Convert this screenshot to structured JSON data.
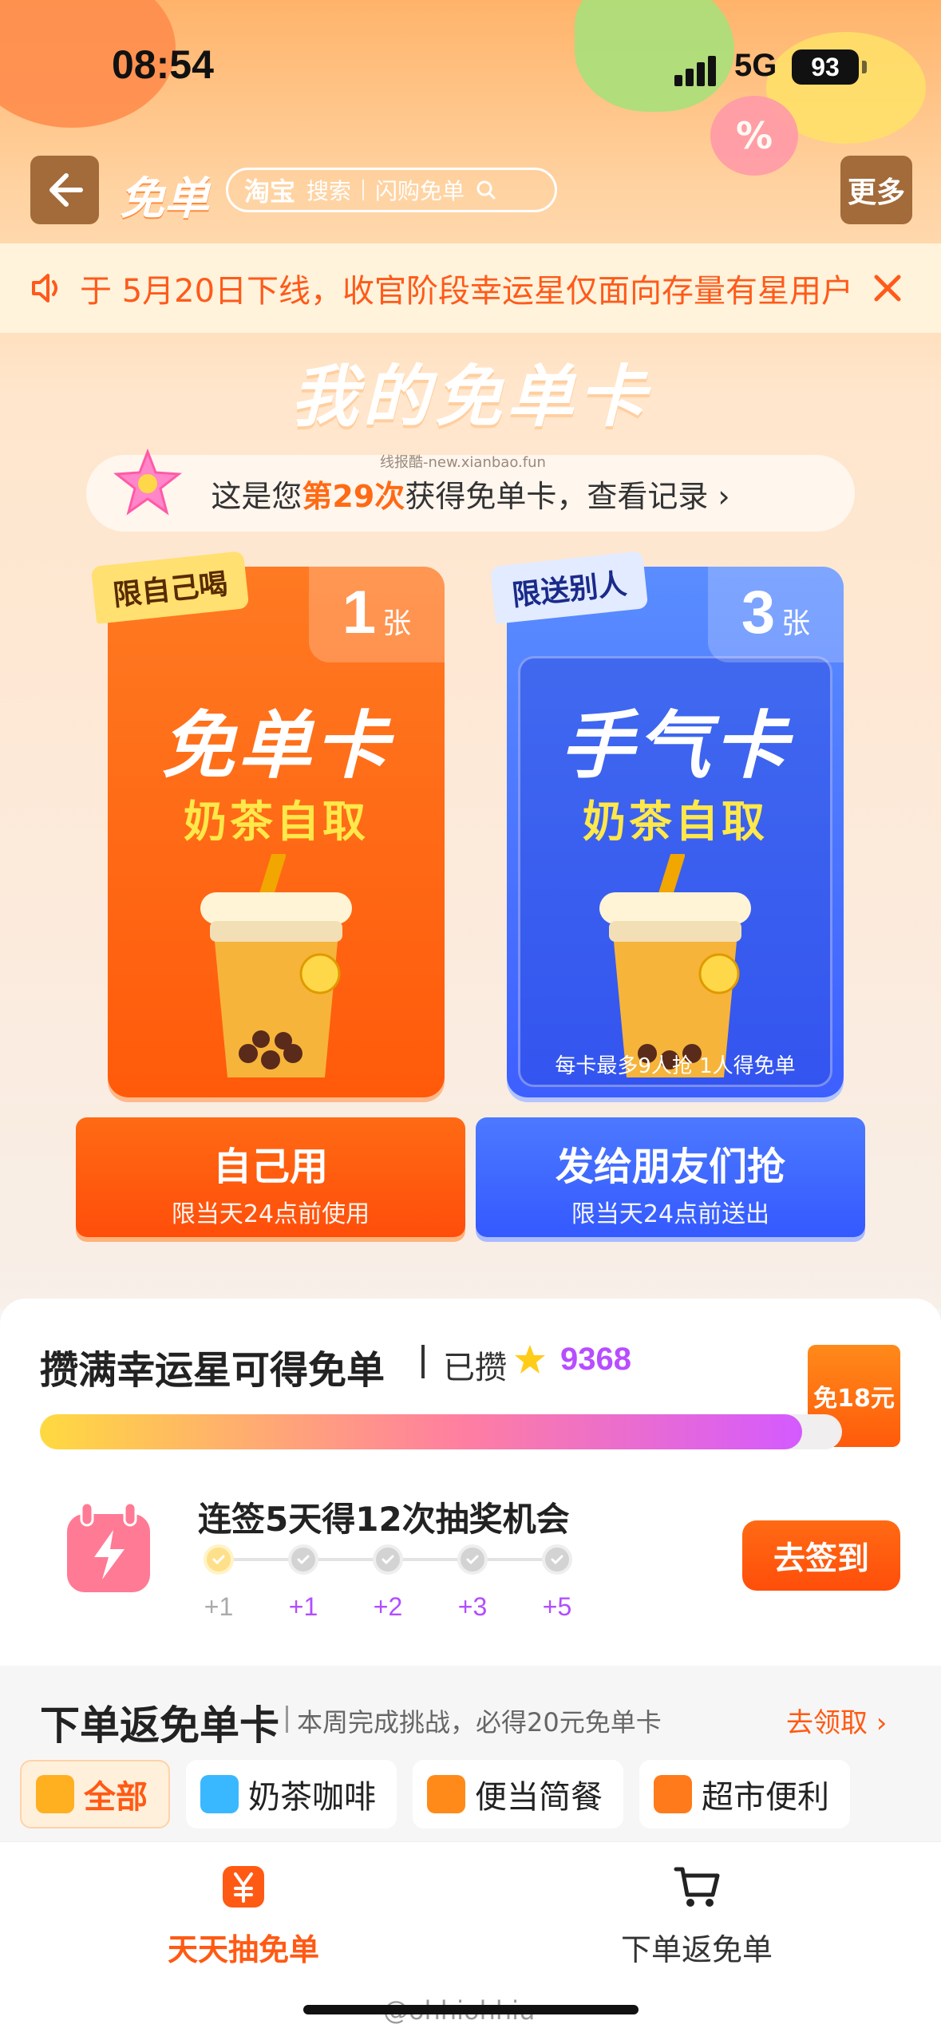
{
  "status_bar": {
    "time": "08:54",
    "network": "5G",
    "battery": "93"
  },
  "nav": {
    "title": "免单",
    "search_brand": "淘宝",
    "search_label": "搜索",
    "search_hint": "闪购免单",
    "more_label": "更多"
  },
  "notice": {
    "text": "于 5月20日下线，收官阶段幸运星仅面向存量有星用户"
  },
  "section": {
    "title": "我的免单卡",
    "watermark": "线报酷-new.xianbao.fun"
  },
  "record": {
    "prefix": "这是您",
    "highlight": "第29次",
    "suffix": "获得免单卡，查看记录 ›"
  },
  "cards": [
    {
      "tag": "限自己喝",
      "count": "1",
      "unit": "张",
      "title": "免单卡",
      "subtitle": "奶茶自取",
      "note": "",
      "btn_main": "自己用",
      "btn_sub": "限当天24点前使用"
    },
    {
      "tag": "限送别人",
      "count": "3",
      "unit": "张",
      "title": "手气卡",
      "subtitle": "奶茶自取",
      "note": "每卡最多9人抢 1人得免单",
      "btn_main": "发给朋友们抢",
      "btn_sub": "限当天24点前送出"
    }
  ],
  "lucky": {
    "title": "攒满幸运星可得免单",
    "have_label": "已攒",
    "count": "9368",
    "badge": "免18元",
    "progress": 0.95
  },
  "checkin": {
    "title": "连签5天得12次抽奖机会",
    "button": "去签到",
    "days": [
      {
        "label": "+1",
        "done": true
      },
      {
        "label": "+1",
        "done": false
      },
      {
        "label": "+2",
        "done": false
      },
      {
        "label": "+3",
        "done": false
      },
      {
        "label": "+5",
        "done": false
      }
    ]
  },
  "order": {
    "title": "下单返免单卡",
    "subtitle": "本周完成挑战，必得20元免单卡",
    "link": "去领取 ›",
    "categories": [
      {
        "label": "全部",
        "icon": "bowl-icon",
        "color": "#ffb020",
        "active": true
      },
      {
        "label": "奶茶咖啡",
        "icon": "drink-icon",
        "color": "#3ab8ff",
        "active": false
      },
      {
        "label": "便当简餐",
        "icon": "bento-icon",
        "color": "#ff8a1a",
        "active": false
      },
      {
        "label": "超市便利",
        "icon": "store-icon",
        "color": "#ff7a1a",
        "active": false
      }
    ]
  },
  "tabs": {
    "left": "天天抽免单",
    "right": "下单返免单"
  },
  "footer": {
    "weibo": "@ohhiohhiu"
  },
  "colors": {
    "accent": "#ff5a14",
    "blue": "#3d5fff",
    "purple": "#b24dff"
  }
}
